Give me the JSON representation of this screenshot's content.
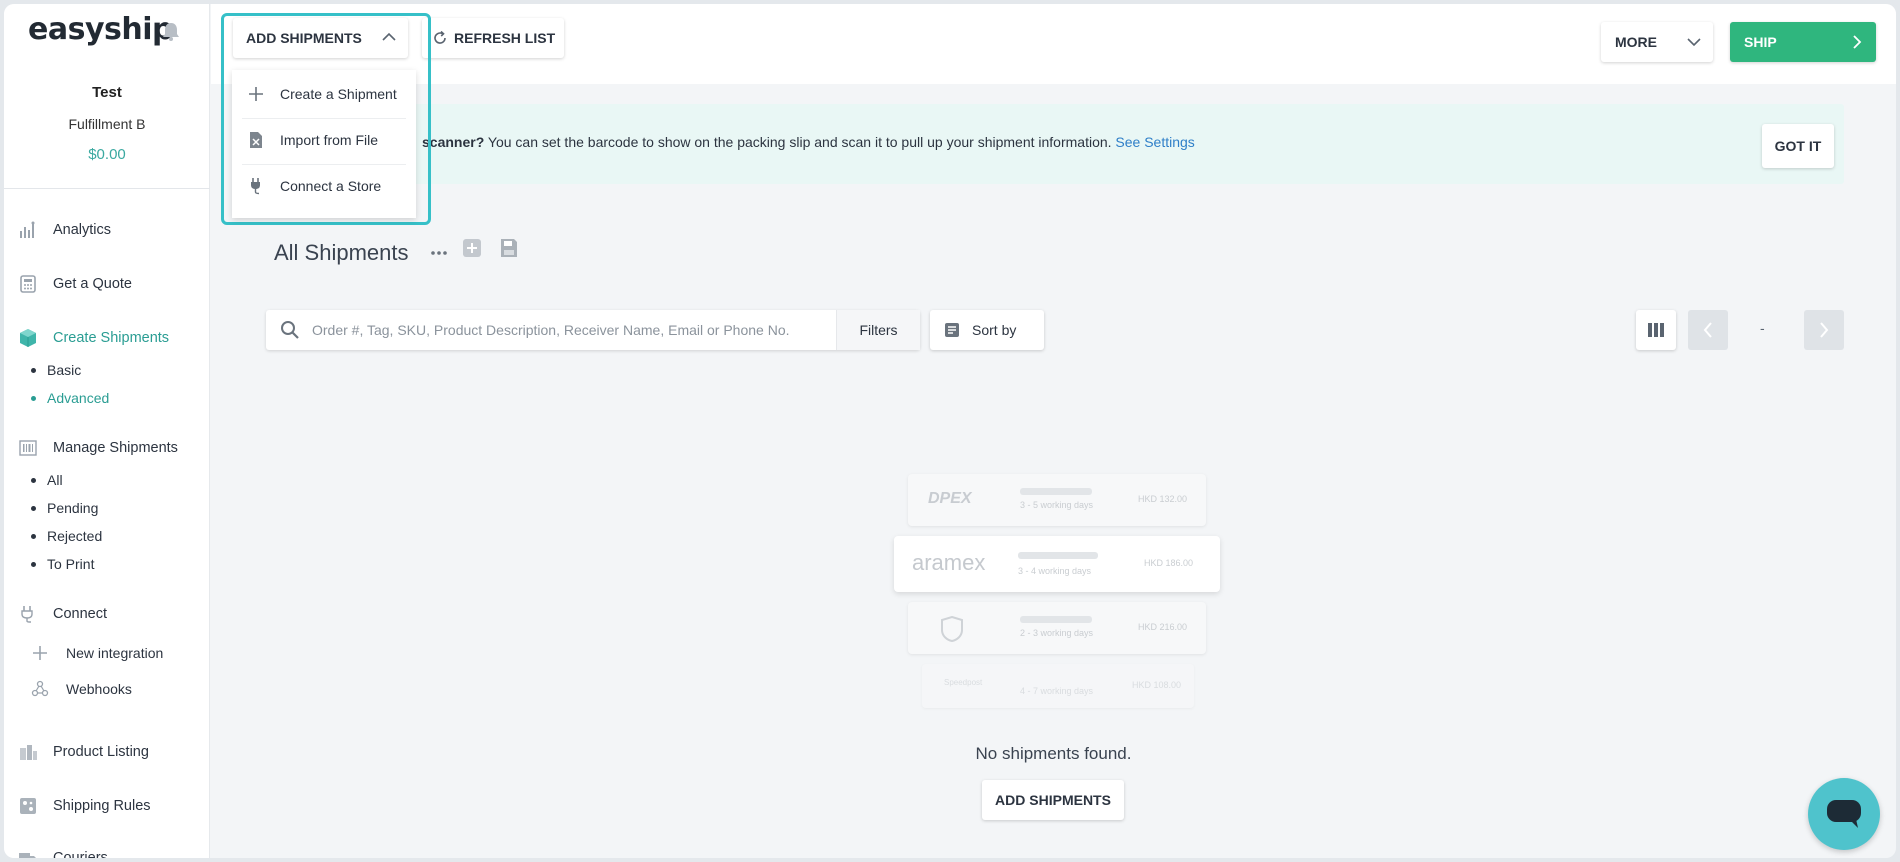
{
  "app": {
    "logo": "easyship"
  },
  "account": {
    "name": "Test",
    "company": "Fulfillment B",
    "balance": "$0.00"
  },
  "sidebar": {
    "items": [
      {
        "label": "Analytics",
        "icon": "analytics-icon"
      },
      {
        "label": "Get a Quote",
        "icon": "calculator-icon"
      },
      {
        "label": "Create Shipments",
        "icon": "box-icon",
        "active": true
      },
      {
        "label": "Manage Shipments",
        "icon": "barcode-icon"
      },
      {
        "label": "Connect",
        "icon": "plug-icon"
      },
      {
        "label": "Product Listing",
        "icon": "product-icon"
      },
      {
        "label": "Shipping Rules",
        "icon": "rules-icon"
      },
      {
        "label": "Couriers",
        "icon": "truck-icon"
      }
    ],
    "create_sub": [
      {
        "label": "Basic"
      },
      {
        "label": "Advanced",
        "active": true
      }
    ],
    "manage_sub": [
      {
        "label": "All"
      },
      {
        "label": "Pending"
      },
      {
        "label": "Rejected"
      },
      {
        "label": "To Print"
      }
    ],
    "connect_sub": [
      {
        "label": "New integration",
        "icon": "plus-icon"
      },
      {
        "label": "Webhooks",
        "icon": "webhook-icon"
      }
    ]
  },
  "toolbar": {
    "add_shipments": "ADD SHIPMENTS",
    "refresh": "REFRESH LIST",
    "more": "MORE",
    "ship": "SHIP"
  },
  "add_menu": [
    {
      "label": "Create a Shipment",
      "icon": "plus-icon"
    },
    {
      "label": "Import from File",
      "icon": "excel-file-icon"
    },
    {
      "label": "Connect a Store",
      "icon": "plug-icon"
    }
  ],
  "banner": {
    "bold": "scanner?",
    "text": " You can set the barcode to show on the packing slip and scan it to pull up your shipment information. ",
    "link": "See Settings",
    "button": "GOT IT"
  },
  "main": {
    "title": "All Shipments",
    "search_placeholder": "Order #, Tag, SKU, Product Description, Receiver Name, Email or Phone No.",
    "filters": "Filters",
    "sort_by": "Sort by",
    "page_indicator": "-",
    "empty_text": "No shipments found.",
    "empty_button": "ADD SHIPMENTS"
  },
  "illustration": {
    "cards": [
      {
        "courier": "DPEX",
        "days": "3 - 5 working days",
        "price": "HKD 132.00"
      },
      {
        "courier": "aramex",
        "days": "3 - 4 working days",
        "price": "HKD 186.00"
      },
      {
        "courier": "UPS",
        "days": "2 - 3 working days",
        "price": "HKD 216.00"
      },
      {
        "courier": "Speedpost",
        "days": "4 - 7 working days",
        "price": "HKD 108.00"
      }
    ]
  },
  "colors": {
    "accent": "#2a9d93",
    "ship": "#2fb67e",
    "highlight": "#36c0c8",
    "chat": "#4fc3cc"
  }
}
